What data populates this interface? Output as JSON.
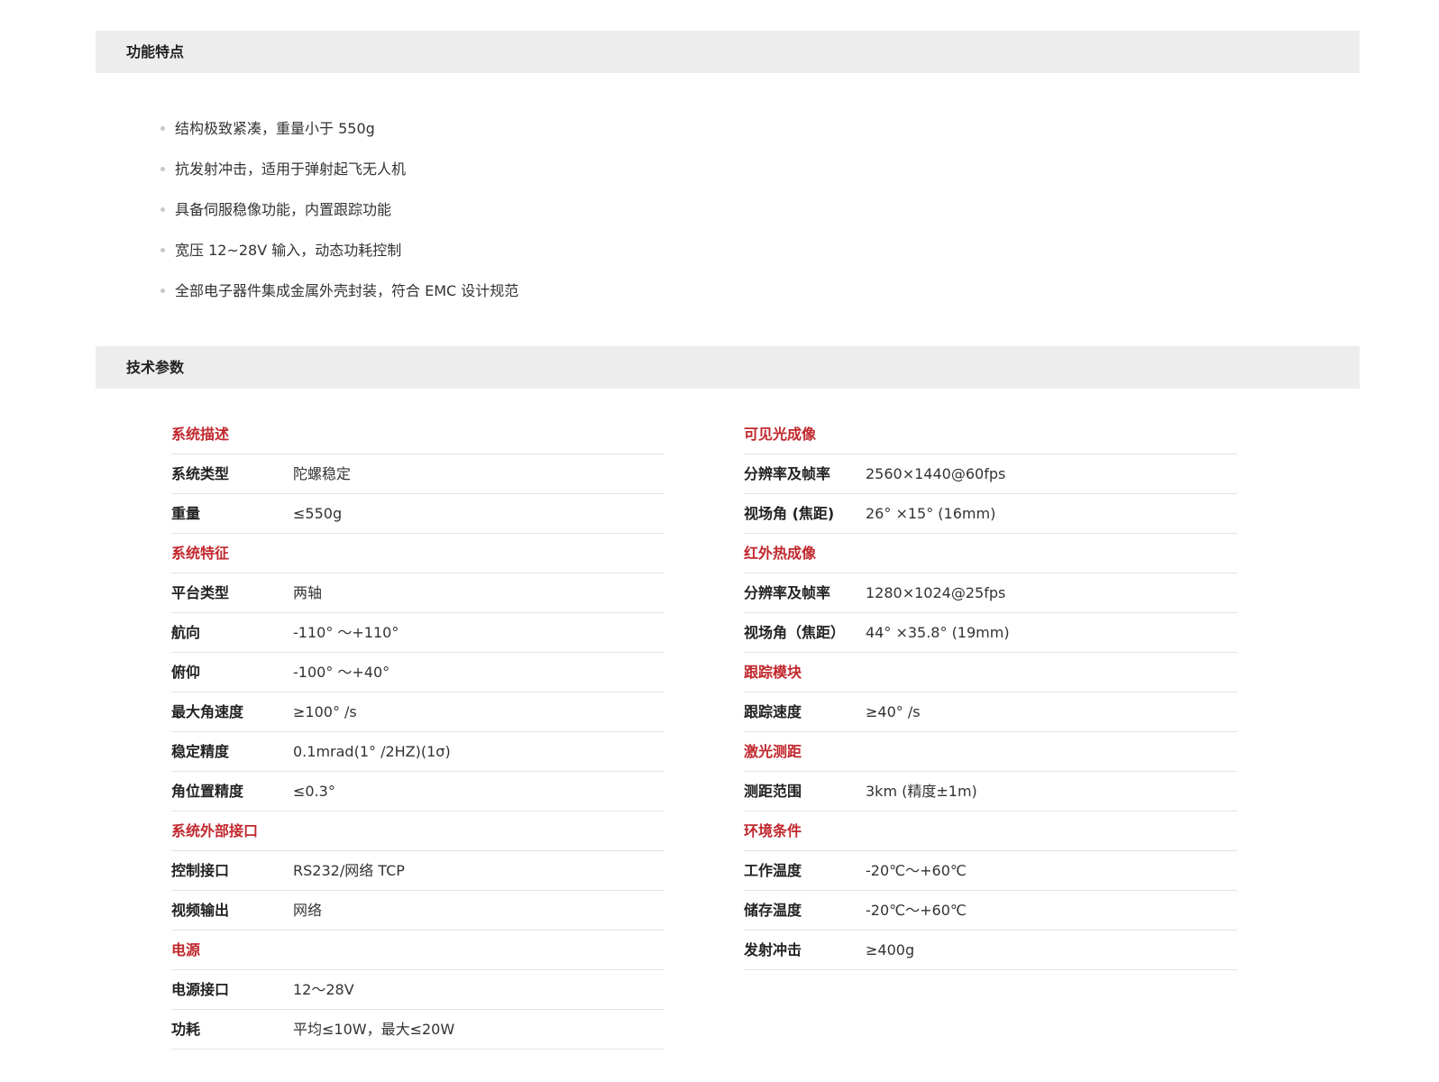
{
  "features": {
    "title": "功能特点",
    "items": [
      "结构极致紧凑，重量小于 550g",
      "抗发射冲击，适用于弹射起飞无人机",
      "具备伺服稳像功能，内置跟踪功能",
      "宽压 12~28V 输入，动态功耗控制",
      "全部电子器件集成金属外壳封装，符合 EMC 设计规范"
    ]
  },
  "specs": {
    "title": "技术参数",
    "left": [
      {
        "type": "head",
        "title": "系统描述"
      },
      {
        "type": "row",
        "label": "系统类型",
        "value": "陀螺稳定"
      },
      {
        "type": "row",
        "label": "重量",
        "value": "≤550g"
      },
      {
        "type": "head",
        "title": "系统特征"
      },
      {
        "type": "row",
        "label": "平台类型",
        "value": "两轴"
      },
      {
        "type": "row",
        "label": "航向",
        "value": "-110° ～+110°"
      },
      {
        "type": "row",
        "label": "俯仰",
        "value": "-100° ～+40°"
      },
      {
        "type": "row",
        "label": "最大角速度",
        "value": "≥100° /s"
      },
      {
        "type": "row",
        "label": "稳定精度",
        "value": "0.1mrad(1° /2HZ)(1σ)"
      },
      {
        "type": "row",
        "label": "角位置精度",
        "value": "≤0.3°"
      },
      {
        "type": "head",
        "title": "系统外部接口"
      },
      {
        "type": "row",
        "label": "控制接口",
        "value": "RS232/网络 TCP"
      },
      {
        "type": "row",
        "label": "视频输出",
        "value": "网络"
      },
      {
        "type": "head",
        "title": "电源"
      },
      {
        "type": "row",
        "label": "电源接口",
        "value": "12～28V"
      },
      {
        "type": "row",
        "label": "功耗",
        "value": "平均≤10W，最大≤20W"
      }
    ],
    "right": [
      {
        "type": "head",
        "title": "可见光成像"
      },
      {
        "type": "row",
        "label": "分辨率及帧率",
        "value": "2560×1440@60fps"
      },
      {
        "type": "row",
        "label": "视场角 (焦距)",
        "value": "26° ×15° (16mm)"
      },
      {
        "type": "head",
        "title": "红外热成像"
      },
      {
        "type": "row",
        "label": "分辨率及帧率",
        "value": "1280×1024@25fps"
      },
      {
        "type": "row",
        "label": "视场角（焦距）",
        "value": "44° ×35.8° (19mm)"
      },
      {
        "type": "head",
        "title": "跟踪模块"
      },
      {
        "type": "row",
        "label": "跟踪速度",
        "value": "≥40° /s"
      },
      {
        "type": "head",
        "title": "激光测距"
      },
      {
        "type": "row",
        "label": "测距范围",
        "value": "3km (精度±1m)"
      },
      {
        "type": "head",
        "title": "环境条件"
      },
      {
        "type": "row",
        "label": "工作温度",
        "value": "-20℃～+60℃"
      },
      {
        "type": "row",
        "label": "储存温度",
        "value": "-20℃～+60℃"
      },
      {
        "type": "row",
        "label": "发射冲击",
        "value": "≥400g"
      }
    ]
  },
  "colors": {
    "accent": "#c1272d",
    "bar_bg": "#ededed",
    "divider": "#e3e3e3"
  }
}
